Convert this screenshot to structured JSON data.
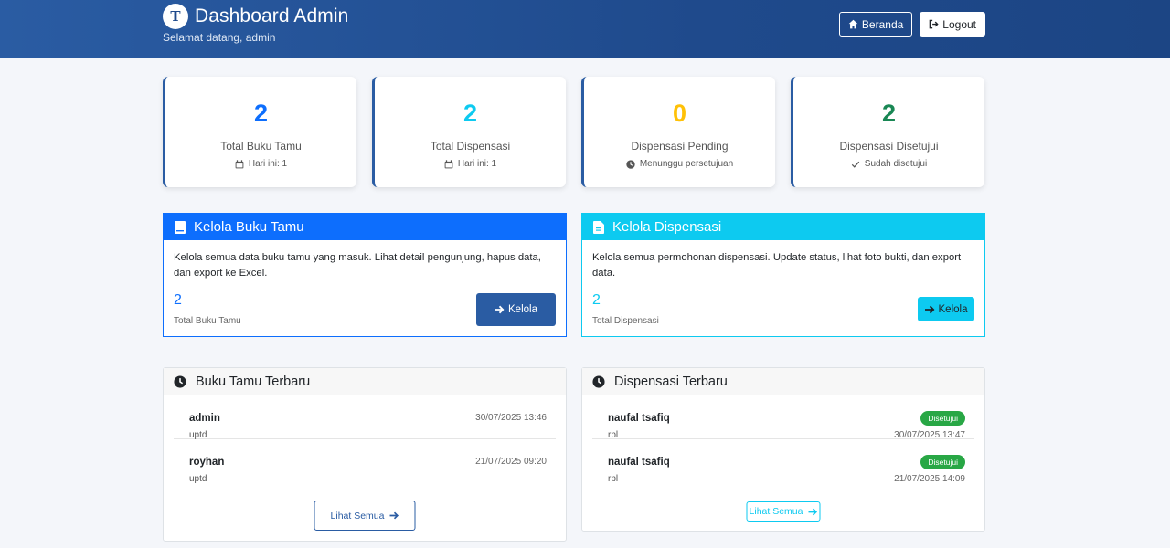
{
  "header": {
    "logo_letter": "T",
    "title": "Dashboard Admin",
    "subtitle": "Selamat datang, admin",
    "home_label": "Beranda",
    "logout_label": "Logout"
  },
  "stats": [
    {
      "value": "2",
      "label": "Total Buku Tamu",
      "sub": "Hari ini: 1",
      "sub_icon": "calendar-icon",
      "color": "#0d6efd"
    },
    {
      "value": "2",
      "label": "Total Dispensasi",
      "sub": "Hari ini: 1",
      "sub_icon": "calendar-icon",
      "color": "#0dcaf0"
    },
    {
      "value": "0",
      "label": "Dispensasi Pending",
      "sub": "Menunggu persetujuan",
      "sub_icon": "clock-icon",
      "color": "#ffc107"
    },
    {
      "value": "2",
      "label": "Dispensasi Disetujui",
      "sub": "Sudah disetujui",
      "sub_icon": "check-icon",
      "color": "#198754"
    }
  ],
  "panels": {
    "guestbook": {
      "title": "Kelola Buku Tamu",
      "icon": "book-icon",
      "description": "Kelola semua data buku tamu yang masuk. Lihat detail pengunjung, hapus data, dan export ke Excel.",
      "count": "2",
      "count_label": "Total Buku Tamu",
      "button_label": "Kelola",
      "color": "#0d6efd"
    },
    "dispensation": {
      "title": "Kelola Dispensasi",
      "icon": "file-icon",
      "description": "Kelola semua permohonan dispensasi. Update status, lihat foto bukti, dan export data.",
      "count": "2",
      "count_label": "Total Dispensasi",
      "button_label": "Kelola",
      "color": "#0dcaf0"
    }
  },
  "recent_guestbook": {
    "title": "Buku Tamu Terbaru",
    "items": [
      {
        "name": "admin",
        "org": "uptd",
        "timestamp": "30/07/2025 13:46"
      },
      {
        "name": "royhan",
        "org": "uptd",
        "timestamp": "21/07/2025 09:20"
      }
    ],
    "see_all_label": "Lihat Semua"
  },
  "recent_dispensation": {
    "title": "Dispensasi Terbaru",
    "items": [
      {
        "name": "naufal tsafiq",
        "org": "rpl",
        "status": "Disetujui",
        "timestamp": "30/07/2025 13:47"
      },
      {
        "name": "naufal tsafiq",
        "org": "rpl",
        "status": "Disetujui",
        "timestamp": "21/07/2025 14:09"
      }
    ],
    "see_all_label": "Lihat Semua"
  },
  "colors": {
    "header_bg": "#2a5ca3",
    "primary_dark": "#2a5ca3",
    "success": "#28a745"
  }
}
